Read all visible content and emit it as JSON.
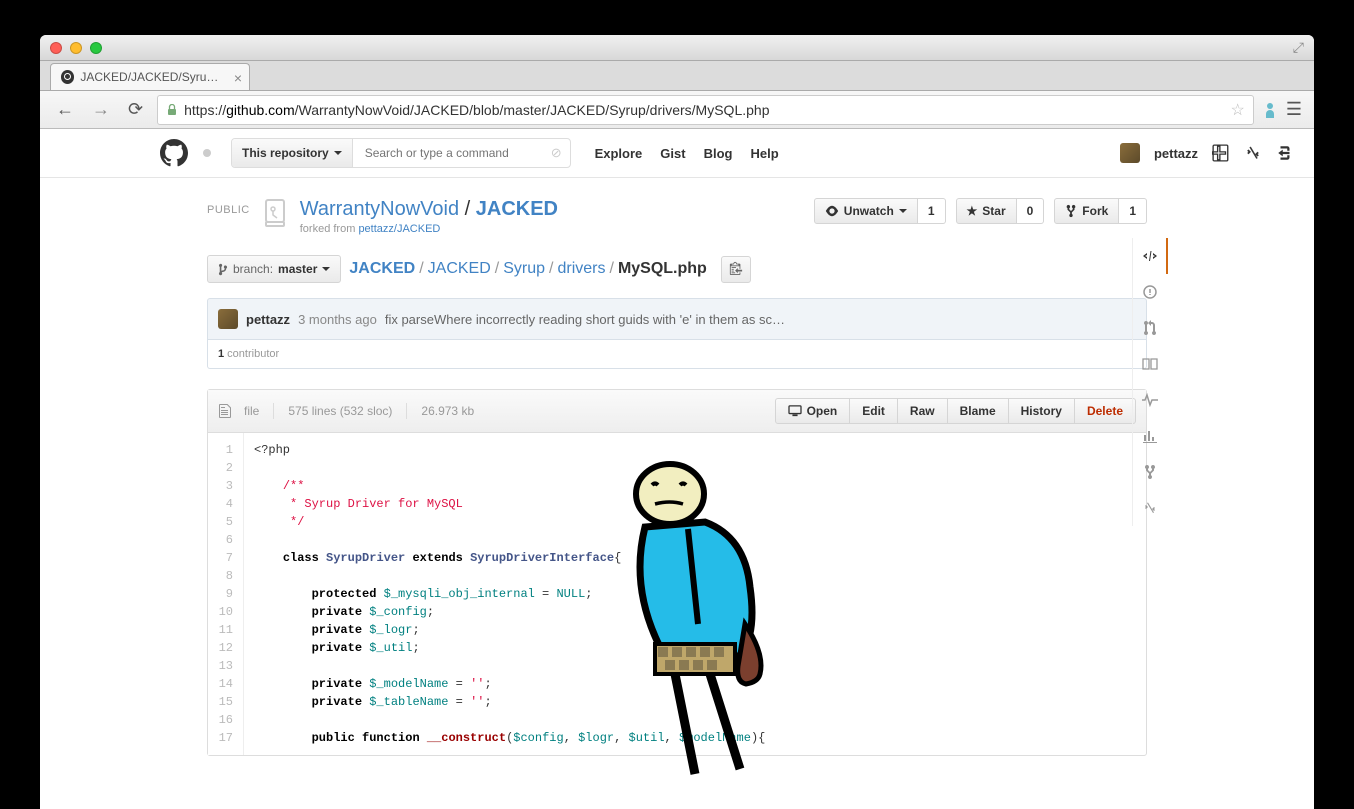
{
  "browser": {
    "tab_title": "JACKED/JACKED/Syrup/dri",
    "url_prefix": "https://",
    "url_host": "github.com",
    "url_path": "/WarrantyNowVoid/JACKED/blob/master/JACKED/Syrup/drivers/MySQL.php"
  },
  "header": {
    "search_scope": "This repository",
    "search_placeholder": "Search or type a command",
    "links": {
      "explore": "Explore",
      "gist": "Gist",
      "blog": "Blog",
      "help": "Help"
    },
    "username": "pettazz"
  },
  "repo": {
    "public_label": "PUBLIC",
    "owner": "WarrantyNowVoid",
    "name": "JACKED",
    "forked_label": "forked from ",
    "forked_from": "pettazz/JACKED",
    "actions": {
      "unwatch": "Unwatch",
      "unwatch_count": "1",
      "star": "Star",
      "star_count": "0",
      "fork": "Fork",
      "fork_count": "1"
    }
  },
  "branch": {
    "label": "branch:",
    "name": "master"
  },
  "breadcrumb": {
    "p1": "JACKED",
    "p2": "JACKED",
    "p3": "Syrup",
    "p4": "drivers",
    "file": "MySQL.php"
  },
  "commit": {
    "author": "pettazz",
    "time": "3 months ago",
    "message": "fix parseWhere incorrectly reading short guids with 'e' in them as sc…"
  },
  "contributors": {
    "count": "1",
    "label": " contributor"
  },
  "file": {
    "type": "file",
    "lines": "575 lines (532 sloc)",
    "size": "26.973 kb",
    "buttons": {
      "open": "Open",
      "edit": "Edit",
      "raw": "Raw",
      "blame": "Blame",
      "history": "History",
      "delete": "Delete"
    }
  },
  "code": {
    "line_numbers": [
      "1",
      "2",
      "3",
      "4",
      "5",
      "6",
      "7",
      "8",
      "9",
      "10",
      "11",
      "12",
      "13",
      "14",
      "15",
      "16",
      "17"
    ]
  }
}
